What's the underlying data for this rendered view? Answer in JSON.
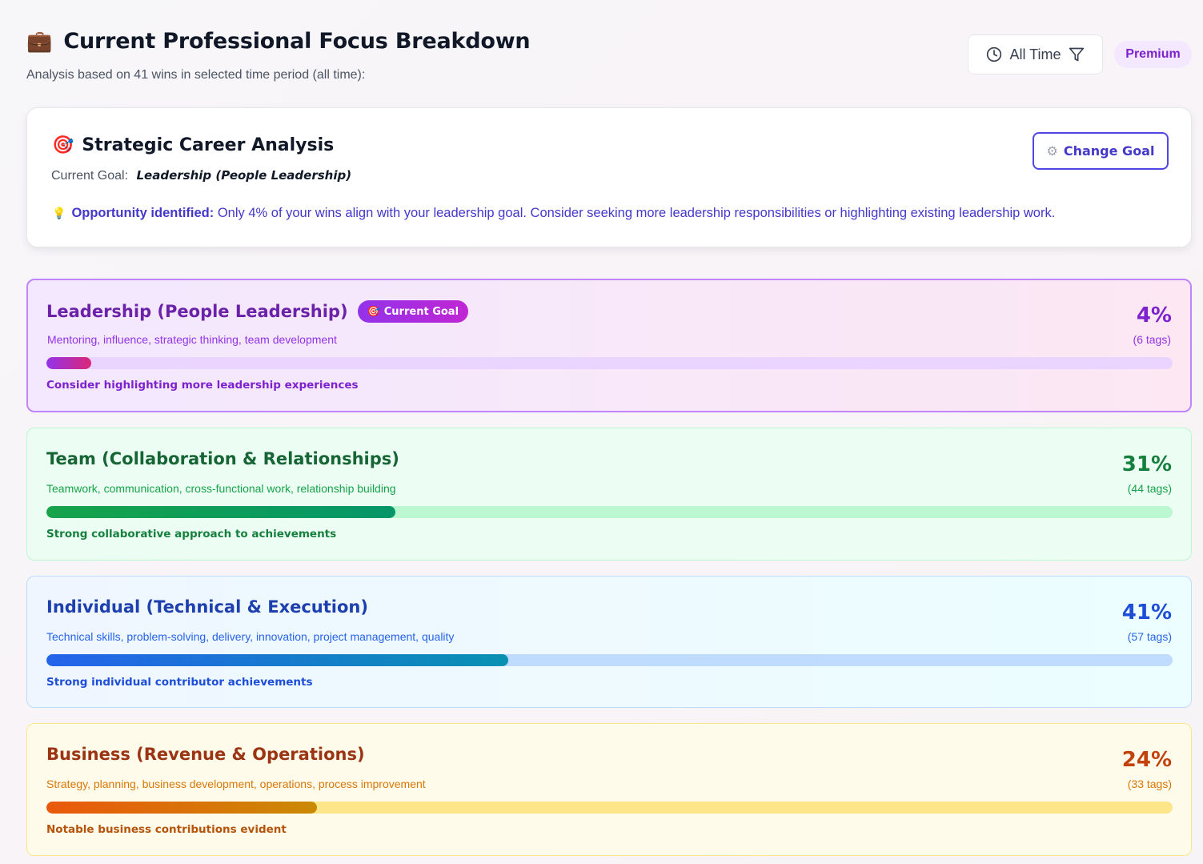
{
  "header": {
    "icon": "briefcase-icon",
    "title": "Current Professional Focus Breakdown",
    "subtitle": "Analysis based on 41 wins in selected time period (all time):"
  },
  "filter": {
    "label": "All Time",
    "clock_icon": "clock-icon",
    "filter_icon": "filter-icon"
  },
  "premium_badge": "Premium",
  "strategic": {
    "icon": "target-icon",
    "title": "Strategic Career Analysis",
    "goal_label": "Current Goal:",
    "goal_value": "Leadership (People Leadership)",
    "change_goal_label": "Change Goal",
    "opportunity_label": "Opportunity identified:",
    "opportunity_text": " Only 4% of your wins align with your leadership goal. Consider seeking more leadership responsibilities or highlighting existing leadership work."
  },
  "categories": [
    {
      "name": "Leadership (People Leadership)",
      "badge": "Current Goal",
      "description": "Mentoring, influence, strategic thinking, team development",
      "percent": "4%",
      "progress": 0.04,
      "tags": "(6 tags)",
      "note": "Consider highlighting more leadership experiences"
    },
    {
      "name": "Team (Collaboration & Relationships)",
      "description": "Teamwork, communication, cross-functional work, relationship building",
      "percent": "31%",
      "progress": 0.31,
      "tags": "(44 tags)",
      "note": "Strong collaborative approach to achievements"
    },
    {
      "name": "Individual (Technical & Execution)",
      "description": "Technical skills, problem-solving, delivery, innovation, project management, quality",
      "percent": "41%",
      "progress": 0.41,
      "tags": "(57 tags)",
      "note": "Strong individual contributor achievements"
    },
    {
      "name": "Business (Revenue & Operations)",
      "description": "Strategy, planning, business development, operations, process improvement",
      "percent": "24%",
      "progress": 0.24,
      "tags": "(33 tags)",
      "note": "Notable business contributions evident"
    }
  ]
}
